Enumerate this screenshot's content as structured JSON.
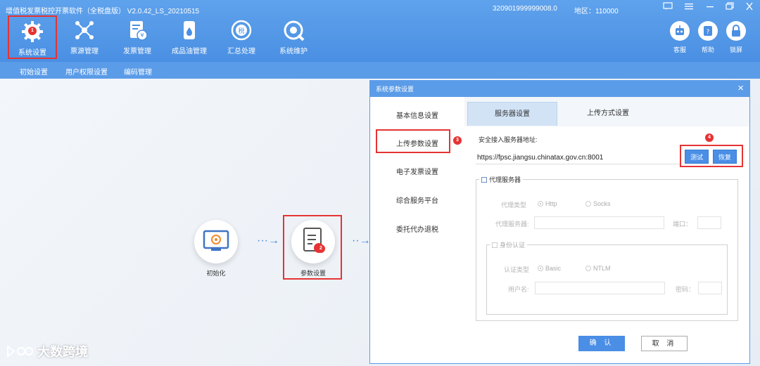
{
  "header": {
    "title": "增值税发票税控开票软件（全税盘版） V2.0.42_LS_20210515",
    "serial": "320901999999008.0",
    "region": "地区：110000",
    "menu": [
      {
        "label": "系统设置",
        "icon": "gear-icon"
      },
      {
        "label": "票源管理",
        "icon": "network-icon"
      },
      {
        "label": "发票管理",
        "icon": "invoice-icon"
      },
      {
        "label": "成品油管理",
        "icon": "oil-drum-icon"
      },
      {
        "label": "汇总处理",
        "icon": "summary-icon"
      },
      {
        "label": "系统维护",
        "icon": "wrench-icon"
      }
    ],
    "tools": [
      {
        "label": "客服",
        "icon": "robot-icon"
      },
      {
        "label": "帮助",
        "icon": "help-icon"
      },
      {
        "label": "锁屏",
        "icon": "lock-icon"
      }
    ],
    "window_controls": [
      "message-icon",
      "menu-icon",
      "minimize-icon",
      "restore-icon",
      "close-icon"
    ]
  },
  "subnav": [
    "初始设置",
    "用户权限设置",
    "编码管理"
  ],
  "flow": {
    "step1": "初始化",
    "step2": "参数设置"
  },
  "annotations": [
    "1",
    "2",
    "3",
    "4"
  ],
  "dialog": {
    "title": "系统参数设置",
    "sidebar": [
      "基本信息设置",
      "上传参数设置",
      "电子发票设置",
      "综合服务平台",
      "委托代办退税"
    ],
    "tabs": [
      "服务器设置",
      "上传方式设置"
    ],
    "server_label": "安全接入服务器地址:",
    "server_url": "https://fpsc.jiangsu.chinatax.gov.cn:8001",
    "test_btn": "测试",
    "restore_btn": "恢复",
    "proxy": {
      "legend": "代理服务器",
      "type_label": "代理类型",
      "opt_http": "Http",
      "opt_socks": "Socks",
      "server_label": "代理服务器:",
      "port_label": "端口：",
      "auth": {
        "legend": "身份认证",
        "type_label": "认证类型",
        "opt_basic": "Basic",
        "opt_ntlm": "NTLM",
        "user_label": "用户名:",
        "pass_label": "密码："
      }
    },
    "ok_btn": "确 认",
    "cancel_btn": "取 消"
  },
  "watermark": "大数跨境",
  "colors": {
    "header": "#4a8fe3",
    "accent": "#4a8ee6",
    "highlight": "#e53333"
  }
}
